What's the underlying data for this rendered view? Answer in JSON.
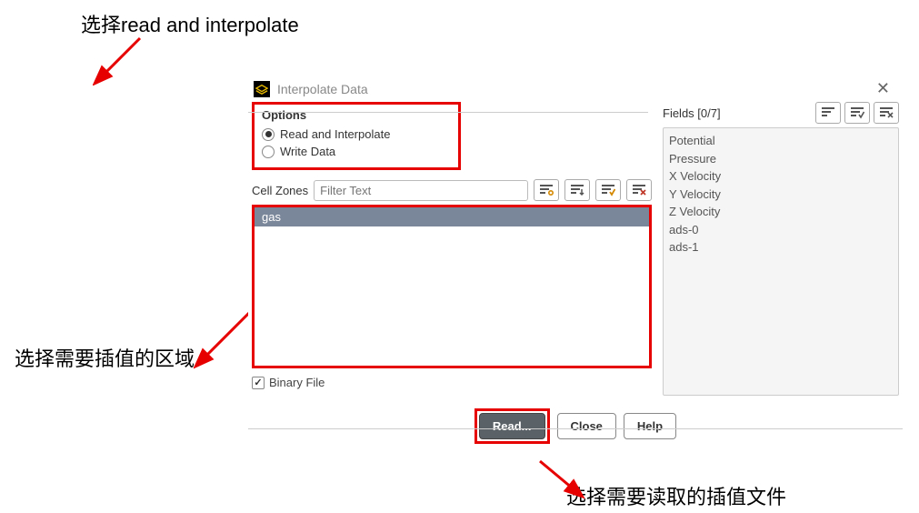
{
  "annotations": {
    "top": "选择read and interpolate",
    "left": "选择需要插值的区域",
    "bottom": "选择需要读取的插值文件"
  },
  "dialog": {
    "title": "Interpolate Data",
    "options": {
      "heading": "Options",
      "read_label": "Read and Interpolate",
      "write_label": "Write Data"
    },
    "cell_zones": {
      "label": "Cell Zones",
      "filter_placeholder": "Filter Text",
      "items": [
        "gas"
      ]
    },
    "binary_label": "Binary File",
    "fields": {
      "label": "Fields [0/7]",
      "items": [
        "Potential",
        "Pressure",
        "X Velocity",
        "Y Velocity",
        "Z Velocity",
        "ads-0",
        "ads-1"
      ]
    },
    "buttons": {
      "read": "Read...",
      "close": "Close",
      "help": "Help"
    }
  }
}
